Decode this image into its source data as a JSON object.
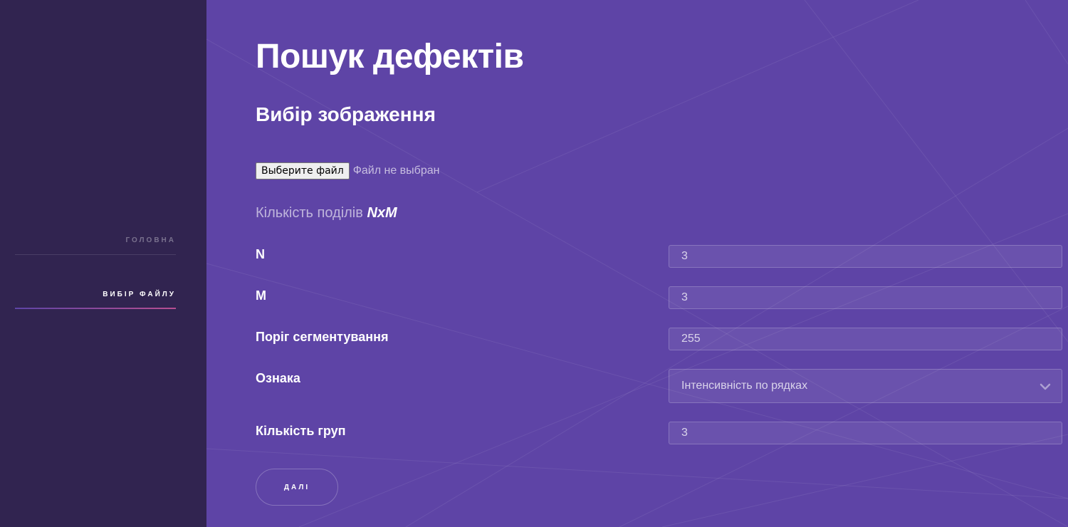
{
  "sidebar": {
    "items": [
      {
        "label": "ГОЛОВНА",
        "active": false
      },
      {
        "label": "ВИБІР ФАЙЛУ",
        "active": true
      }
    ]
  },
  "main": {
    "title": "Пошук дефектів",
    "subtitle": "Вибір зображення",
    "file": {
      "button_label": "Выберите файл",
      "status": "Файл не выбран"
    },
    "divisions": {
      "label": "Кількість поділів",
      "emphasis": "NxM"
    },
    "fields": {
      "n": {
        "label": "N",
        "value": "3"
      },
      "m": {
        "label": "M",
        "value": "3"
      },
      "threshold": {
        "label": "Поріг сегментування",
        "value": "255"
      },
      "feature": {
        "label": "Ознака",
        "selected": "Інтенсивність по рядках"
      },
      "groups": {
        "label": "Кількість груп",
        "value": "3"
      }
    },
    "next_label": "ДАЛІ"
  },
  "colors": {
    "background": "#5e44a6",
    "sidebar": "#312450",
    "accent": "#b74e91"
  },
  "icons": {
    "select": "chevron-down-icon"
  }
}
